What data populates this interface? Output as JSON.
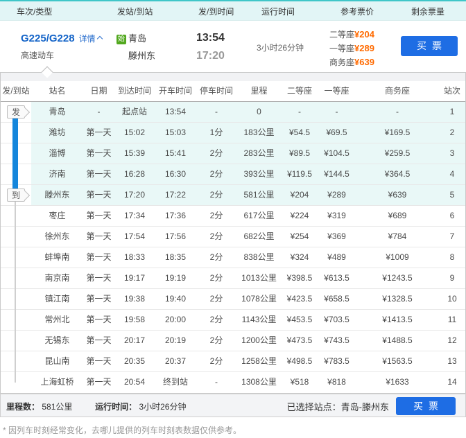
{
  "list_header": {
    "cols": [
      "车次/类型",
      "发站/到站",
      "发/到时间",
      "运行时间",
      "参考票价",
      "剩余票量"
    ]
  },
  "train": {
    "number": "G225/G228",
    "detail_label": "详情",
    "train_type": "高速动车",
    "start_badge": "始",
    "from_station": "青岛",
    "to_station": "滕州东",
    "depart_time": "13:54",
    "arrive_time": "17:20",
    "duration": "3小时26分钟",
    "prices": [
      {
        "label": "二等座",
        "value": "¥204"
      },
      {
        "label": "一等座",
        "value": "¥289"
      },
      {
        "label": "商务座",
        "value": "¥639"
      }
    ],
    "buy_button": "买票"
  },
  "timetable": {
    "columns": [
      "发/到站",
      "站名",
      "日期",
      "到达时间",
      "开车时间",
      "停车时间",
      "里程",
      "二等座",
      "一等座",
      "商务座",
      "站次"
    ],
    "depart_badge": "发",
    "arrive_badge": "到",
    "rows": [
      {
        "station": "青岛",
        "date": "-",
        "arrive": "起点站",
        "depart": "13:54",
        "stop": "-",
        "distance": "0",
        "seat2": "-",
        "seat1": "-",
        "business": "-",
        "seq": "1",
        "highlight": true
      },
      {
        "station": "潍坊",
        "date": "第一天",
        "arrive": "15:02",
        "depart": "15:03",
        "stop": "1分",
        "distance": "183公里",
        "seat2": "¥54.5",
        "seat1": "¥69.5",
        "business": "¥169.5",
        "seq": "2",
        "highlight": true
      },
      {
        "station": "淄博",
        "date": "第一天",
        "arrive": "15:39",
        "depart": "15:41",
        "stop": "2分",
        "distance": "283公里",
        "seat2": "¥89.5",
        "seat1": "¥104.5",
        "business": "¥259.5",
        "seq": "3",
        "highlight": true
      },
      {
        "station": "济南",
        "date": "第一天",
        "arrive": "16:28",
        "depart": "16:30",
        "stop": "2分",
        "distance": "393公里",
        "seat2": "¥119.5",
        "seat1": "¥144.5",
        "business": "¥364.5",
        "seq": "4",
        "highlight": true
      },
      {
        "station": "滕州东",
        "date": "第一天",
        "arrive": "17:20",
        "depart": "17:22",
        "stop": "2分",
        "distance": "581公里",
        "seat2": "¥204",
        "seat1": "¥289",
        "business": "¥639",
        "seq": "5",
        "highlight": true
      },
      {
        "station": "枣庄",
        "date": "第一天",
        "arrive": "17:34",
        "depart": "17:36",
        "stop": "2分",
        "distance": "617公里",
        "seat2": "¥224",
        "seat1": "¥319",
        "business": "¥689",
        "seq": "6",
        "highlight": false
      },
      {
        "station": "徐州东",
        "date": "第一天",
        "arrive": "17:54",
        "depart": "17:56",
        "stop": "2分",
        "distance": "682公里",
        "seat2": "¥254",
        "seat1": "¥369",
        "business": "¥784",
        "seq": "7",
        "highlight": false
      },
      {
        "station": "蚌埠南",
        "date": "第一天",
        "arrive": "18:33",
        "depart": "18:35",
        "stop": "2分",
        "distance": "838公里",
        "seat2": "¥324",
        "seat1": "¥489",
        "business": "¥1009",
        "seq": "8",
        "highlight": false
      },
      {
        "station": "南京南",
        "date": "第一天",
        "arrive": "19:17",
        "depart": "19:19",
        "stop": "2分",
        "distance": "1013公里",
        "seat2": "¥398.5",
        "seat1": "¥613.5",
        "business": "¥1243.5",
        "seq": "9",
        "highlight": false
      },
      {
        "station": "镇江南",
        "date": "第一天",
        "arrive": "19:38",
        "depart": "19:40",
        "stop": "2分",
        "distance": "1078公里",
        "seat2": "¥423.5",
        "seat1": "¥658.5",
        "business": "¥1328.5",
        "seq": "10",
        "highlight": false
      },
      {
        "station": "常州北",
        "date": "第一天",
        "arrive": "19:58",
        "depart": "20:00",
        "stop": "2分",
        "distance": "1143公里",
        "seat2": "¥453.5",
        "seat1": "¥703.5",
        "business": "¥1413.5",
        "seq": "11",
        "highlight": false
      },
      {
        "station": "无锡东",
        "date": "第一天",
        "arrive": "20:17",
        "depart": "20:19",
        "stop": "2分",
        "distance": "1200公里",
        "seat2": "¥473.5",
        "seat1": "¥743.5",
        "business": "¥1488.5",
        "seq": "12",
        "highlight": false
      },
      {
        "station": "昆山南",
        "date": "第一天",
        "arrive": "20:35",
        "depart": "20:37",
        "stop": "2分",
        "distance": "1258公里",
        "seat2": "¥498.5",
        "seat1": "¥783.5",
        "business": "¥1563.5",
        "seq": "13",
        "highlight": false
      },
      {
        "station": "上海虹桥",
        "date": "第一天",
        "arrive": "20:54",
        "depart": "终到站",
        "stop": "-",
        "distance": "1308公里",
        "seat2": "¥518",
        "seat1": "¥818",
        "business": "¥1633",
        "seq": "14",
        "highlight": false
      }
    ]
  },
  "summary": {
    "mileage_label": "里程数：",
    "mileage_value": "581公里",
    "duration_label": "运行时间：",
    "duration_value": "3小时26分钟",
    "selected_label": "已选择站点：",
    "selected_value": "青岛-滕州东",
    "buy_button": "买票"
  },
  "note": "* 因列车时刻经常变化，去哪儿提供的列车时刻表数据仅供参考。",
  "colors": {
    "accent_teal": "#3fc6c8",
    "header_band_bg": "#e2f5f6",
    "link_blue": "#1464c8",
    "price_orange": "#ff6a00",
    "button_blue": "#1e6de4",
    "highlight_row_bg": "#e9f8f7",
    "route_bar_blue": "#1486dc",
    "start_badge_green": "#52a81f"
  }
}
